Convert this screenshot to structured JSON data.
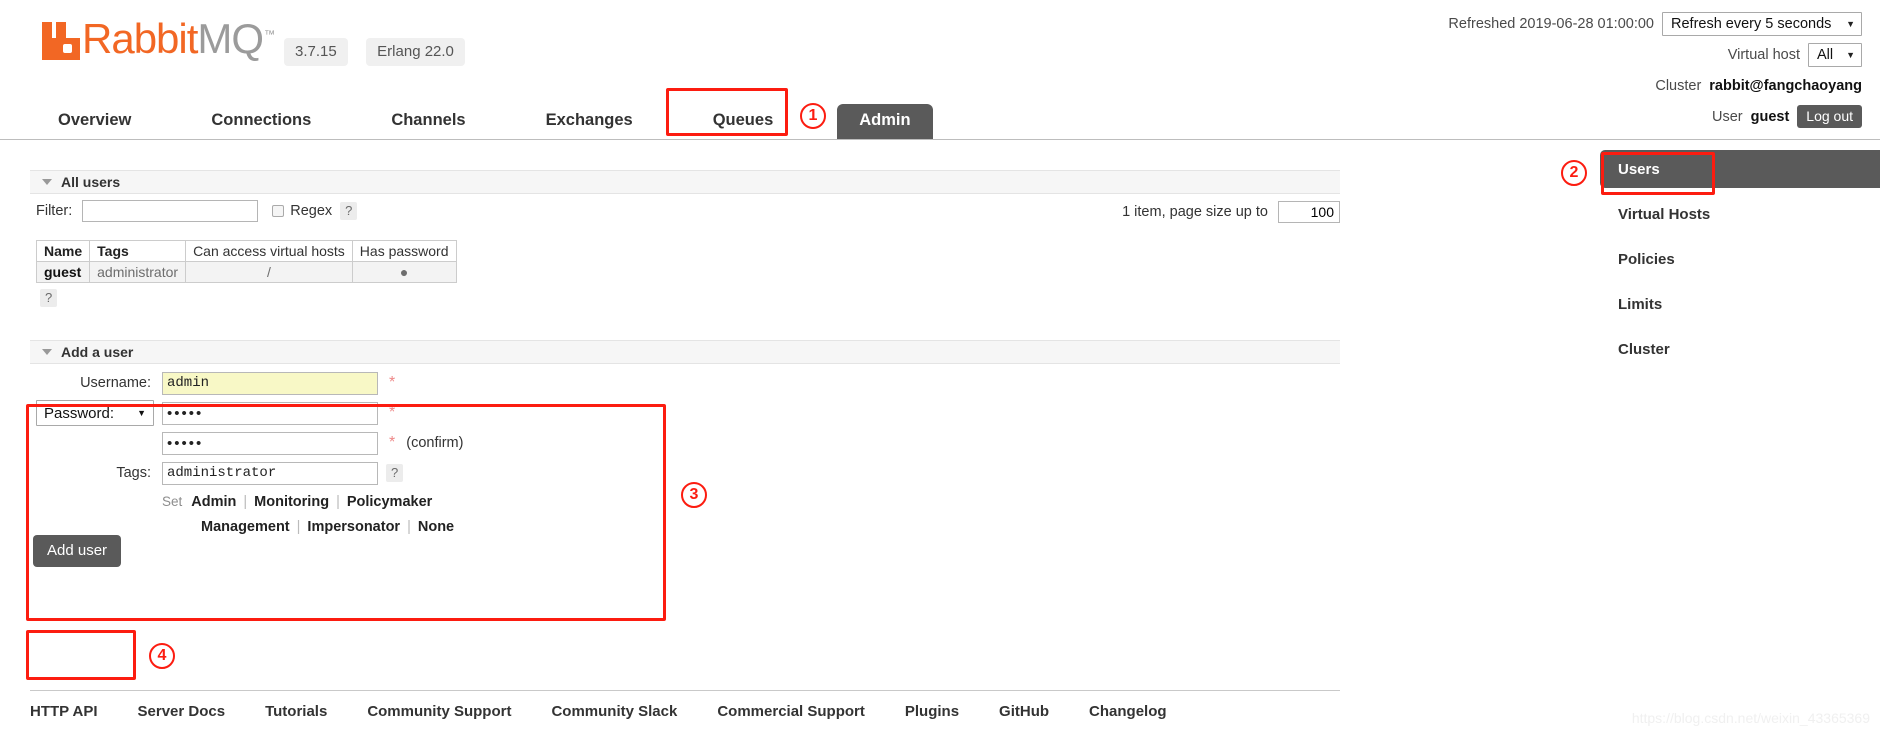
{
  "header": {
    "brand_rabbit": "Rabbit",
    "brand_mq": "MQ",
    "trademark": "™",
    "version": "3.7.15",
    "erlang_version": "Erlang 22.0",
    "refreshed_label": "Refreshed 2019-06-28 01:00:00",
    "refresh_select_value": "Refresh every 5 seconds",
    "vhost_label": "Virtual host",
    "vhost_select_value": "All",
    "cluster_label": "Cluster",
    "cluster_name": "rabbit@fangchaoyang",
    "user_label": "User",
    "user_name": "guest",
    "logout_label": "Log out",
    "caret": "▼",
    "accent_color": "#F26724",
    "tab_active_color": "#5a5a5a"
  },
  "nav": {
    "tabs": [
      {
        "label": "Overview",
        "active": false
      },
      {
        "label": "Connections",
        "active": false
      },
      {
        "label": "Channels",
        "active": false
      },
      {
        "label": "Exchanges",
        "active": false
      },
      {
        "label": "Queues",
        "active": false
      },
      {
        "label": "Admin",
        "active": true
      }
    ]
  },
  "page": {
    "title": "Users"
  },
  "all_users": {
    "section_label": "All users",
    "filter_label": "Filter:",
    "filter_value": "",
    "filter_placeholder": "",
    "regex_label": "Regex",
    "regex_checked": false,
    "help_glyph": "?",
    "pagesize_text": "1 item, page size up to",
    "pagesize_value": "100",
    "table": {
      "columns": [
        "Name",
        "Tags",
        "Can access virtual hosts",
        "Has password"
      ],
      "rows": [
        {
          "name": "guest",
          "tags": "administrator",
          "vhosts": "/",
          "has_password": "●"
        }
      ]
    },
    "table_help_glyph": "?"
  },
  "add_user": {
    "section_label": "Add a user",
    "username_label": "Username:",
    "username_value": "admin",
    "password_select_value": "Password:",
    "password_value": "•••••",
    "password_confirm_value": "•••••",
    "confirm_note": "(confirm)",
    "tags_label": "Tags:",
    "tags_value": "administrator",
    "tags_help_glyph": "?",
    "required_glyph": "*",
    "set_label": "Set",
    "tag_links_row1": [
      "Admin",
      "Monitoring",
      "Policymaker"
    ],
    "tag_links_row2": [
      "Management",
      "Impersonator",
      "None"
    ],
    "separator": "|",
    "submit_label": "Add user",
    "caret": "▼"
  },
  "sidebar": {
    "items": [
      {
        "label": "Users",
        "active": true
      },
      {
        "label": "Virtual Hosts",
        "active": false
      },
      {
        "label": "Policies",
        "active": false
      },
      {
        "label": "Limits",
        "active": false
      },
      {
        "label": "Cluster",
        "active": false
      }
    ]
  },
  "footer": {
    "links": [
      "HTTP API",
      "Server Docs",
      "Tutorials",
      "Community Support",
      "Community Slack",
      "Commercial Support",
      "Plugins",
      "GitHub",
      "Changelog"
    ]
  },
  "annotations": {
    "color": "#fc1c10",
    "markers": [
      {
        "id": "1",
        "label": "①",
        "target": "admin-tab"
      },
      {
        "id": "2",
        "label": "②",
        "target": "sidebar-users"
      },
      {
        "id": "3",
        "label": "③",
        "target": "add-user-form"
      },
      {
        "id": "4",
        "label": "④",
        "target": "add-user-button"
      }
    ]
  },
  "watermark": {
    "text": "https://blog.csdn.net/weixin_43365369"
  }
}
